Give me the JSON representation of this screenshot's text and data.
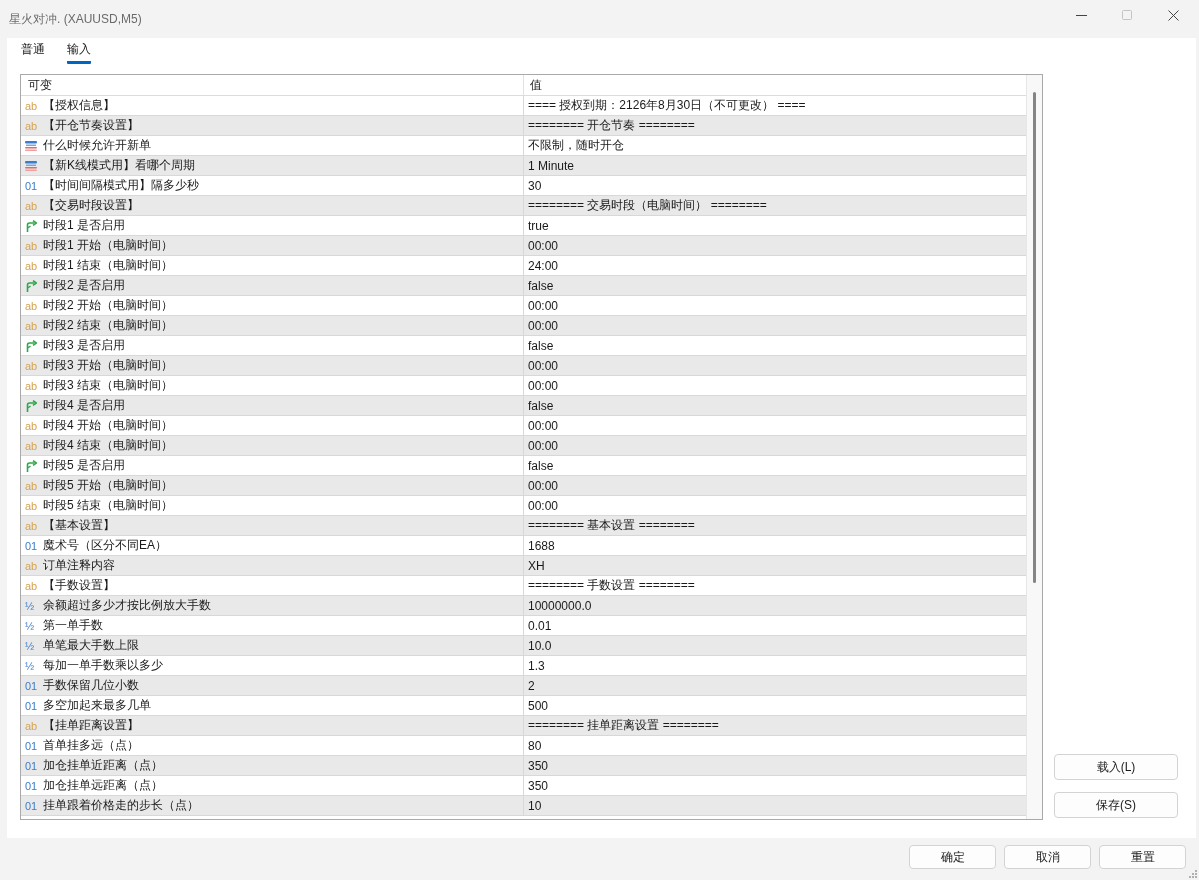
{
  "window": {
    "title": "星火对冲. (XAUUSD,M5)",
    "maximize_disabled": true
  },
  "tabs": [
    {
      "label": "普通",
      "selected": false
    },
    {
      "label": "输入",
      "selected": true
    }
  ],
  "table": {
    "columns": [
      "可变",
      "值"
    ],
    "rows": [
      {
        "kind": "string",
        "type_icon": "ab",
        "name": "【授权信息】",
        "value": "==== 授权到期：2126年8月30日（不可更改） ===="
      },
      {
        "kind": "string",
        "type_icon": "ab",
        "name": "【开仓节奏设置】",
        "value": "======== 开仓节奏 ========"
      },
      {
        "kind": "enum",
        "name": "什么时候允许开新单",
        "value": "不限制，随时开仓"
      },
      {
        "kind": "enum",
        "name": "【新K线模式用】看哪个周期",
        "value": "1 Minute"
      },
      {
        "kind": "integer",
        "type_icon": "01",
        "name": "【时间间隔模式用】隔多少秒",
        "value": "30"
      },
      {
        "kind": "string",
        "type_icon": "ab",
        "name": "【交易时段设置】",
        "value": "======== 交易时段（电脑时间） ========"
      },
      {
        "kind": "bool",
        "name": "时段1 是否启用",
        "value": "true"
      },
      {
        "kind": "string",
        "type_icon": "ab",
        "name": "时段1 开始（电脑时间）",
        "value": "00:00"
      },
      {
        "kind": "string",
        "type_icon": "ab",
        "name": "时段1 结束（电脑时间）",
        "value": "24:00"
      },
      {
        "kind": "bool",
        "name": "时段2 是否启用",
        "value": "false"
      },
      {
        "kind": "string",
        "type_icon": "ab",
        "name": "时段2 开始（电脑时间）",
        "value": "00:00"
      },
      {
        "kind": "string",
        "type_icon": "ab",
        "name": "时段2 结束（电脑时间）",
        "value": "00:00"
      },
      {
        "kind": "bool",
        "name": "时段3 是否启用",
        "value": "false"
      },
      {
        "kind": "string",
        "type_icon": "ab",
        "name": "时段3 开始（电脑时间）",
        "value": "00:00"
      },
      {
        "kind": "string",
        "type_icon": "ab",
        "name": "时段3 结束（电脑时间）",
        "value": "00:00"
      },
      {
        "kind": "bool",
        "name": "时段4 是否启用",
        "value": "false"
      },
      {
        "kind": "string",
        "type_icon": "ab",
        "name": "时段4 开始（电脑时间）",
        "value": "00:00"
      },
      {
        "kind": "string",
        "type_icon": "ab",
        "name": "时段4 结束（电脑时间）",
        "value": "00:00"
      },
      {
        "kind": "bool",
        "name": "时段5 是否启用",
        "value": "false"
      },
      {
        "kind": "string",
        "type_icon": "ab",
        "name": "时段5 开始（电脑时间）",
        "value": "00:00"
      },
      {
        "kind": "string",
        "type_icon": "ab",
        "name": "时段5 结束（电脑时间）",
        "value": "00:00"
      },
      {
        "kind": "string",
        "type_icon": "ab",
        "name": "【基本设置】",
        "value": "======== 基本设置 ========"
      },
      {
        "kind": "integer",
        "type_icon": "01",
        "name": "魔术号（区分不同EA）",
        "value": "1688"
      },
      {
        "kind": "string",
        "type_icon": "ab",
        "name": "订单注释内容",
        "value": "XH"
      },
      {
        "kind": "string",
        "type_icon": "ab",
        "name": "【手数设置】",
        "value": "======== 手数设置 ========"
      },
      {
        "kind": "double",
        "type_icon": "½",
        "name": "余额超过多少才按比例放大手数",
        "value": "10000000.0"
      },
      {
        "kind": "double",
        "type_icon": "½",
        "name": "第一单手数",
        "value": "0.01"
      },
      {
        "kind": "double",
        "type_icon": "½",
        "name": "单笔最大手数上限",
        "value": "10.0"
      },
      {
        "kind": "double",
        "type_icon": "½",
        "name": "每加一单手数乘以多少",
        "value": "1.3"
      },
      {
        "kind": "integer",
        "type_icon": "01",
        "name": "手数保留几位小数",
        "value": "2"
      },
      {
        "kind": "integer",
        "type_icon": "01",
        "name": "多空加起来最多几单",
        "value": "500"
      },
      {
        "kind": "string",
        "type_icon": "ab",
        "name": "【挂单距离设置】",
        "value": "======== 挂单距离设置 ========"
      },
      {
        "kind": "integer",
        "type_icon": "01",
        "name": "首单挂多远（点）",
        "value": "80"
      },
      {
        "kind": "integer",
        "type_icon": "01",
        "name": "加仓挂单近距离（点）",
        "value": "350"
      },
      {
        "kind": "integer",
        "type_icon": "01",
        "name": "加仓挂单远距离（点）",
        "value": "350"
      },
      {
        "kind": "integer",
        "type_icon": "01",
        "name": "挂单跟着价格走的步长（点）",
        "value": "10"
      }
    ]
  },
  "side_buttons": [
    "载入(L)",
    "保存(S)"
  ],
  "footer_buttons": [
    "确定",
    "取消",
    "重置"
  ]
}
